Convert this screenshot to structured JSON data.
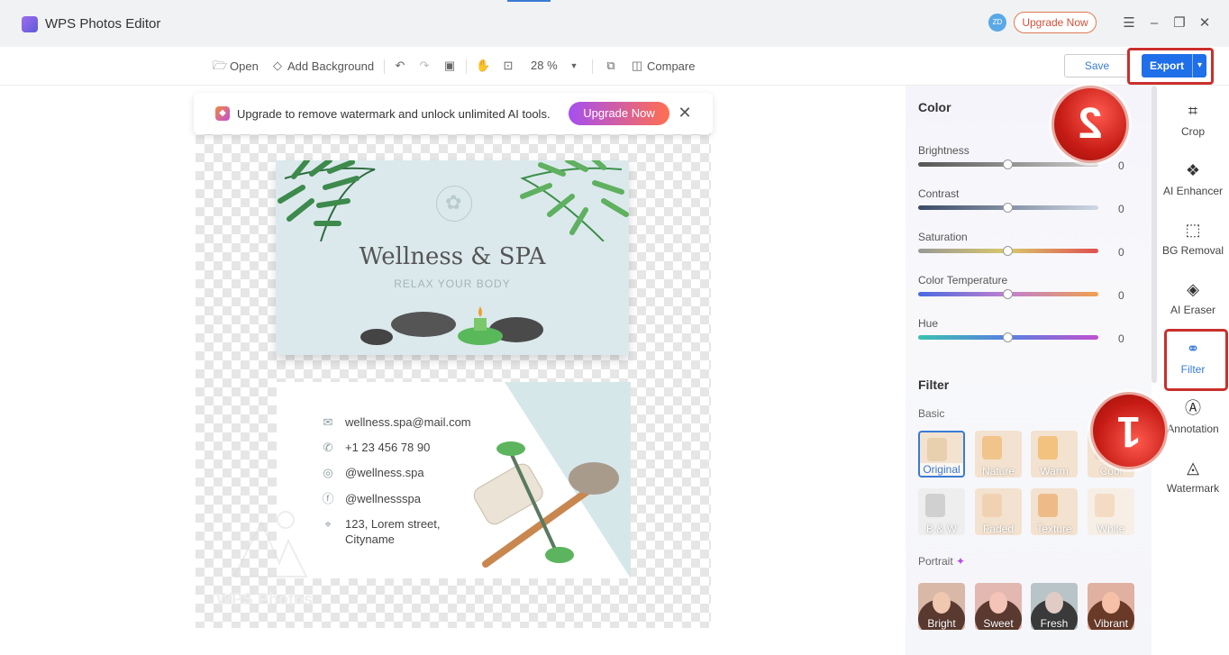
{
  "app": {
    "title": "WPS Photos Editor",
    "avatar": "ZD",
    "upgrade": "Upgrade Now"
  },
  "toolbar": {
    "open": "Open",
    "add_bg": "Add Background",
    "zoom": "28 %",
    "compare": "Compare",
    "save": "Save",
    "export": "Export"
  },
  "banner": {
    "text": "Upgrade to remove watermark and unlock unlimited AI tools.",
    "button": "Upgrade Now"
  },
  "card_front": {
    "title": "Wellness & SPA",
    "subtitle": "RELAX YOUR BODY"
  },
  "card_back": {
    "contacts": [
      {
        "icon": "mail-icon",
        "text": "wellness.spa@mail.com"
      },
      {
        "icon": "phone-icon",
        "text": "+1 23 456 78 90"
      },
      {
        "icon": "instagram-icon",
        "text": "@wellness.spa"
      },
      {
        "icon": "facebook-icon",
        "text": "@wellnessspa"
      },
      {
        "icon": "location-icon",
        "text": "123, Lorem street,\nCityname"
      }
    ]
  },
  "watermark": "WPS Photos",
  "panel": {
    "color_title": "Color",
    "sliders": [
      {
        "label": "Brightness",
        "value": "0"
      },
      {
        "label": "Contrast",
        "value": "0"
      },
      {
        "label": "Saturation",
        "value": "0"
      },
      {
        "label": "Color Temperature",
        "value": "0"
      },
      {
        "label": "Hue",
        "value": "0"
      }
    ],
    "filter_title": "Filter",
    "basic_label": "Basic",
    "basic": [
      "Original",
      "Nature",
      "Warm",
      "Cool",
      "B & W",
      "Faded",
      "Texture",
      "White"
    ],
    "portrait_label": "Portrait",
    "portrait": [
      "Bright",
      "Sweet",
      "Fresh",
      "Vibrant"
    ]
  },
  "tools": [
    {
      "label": "Crop",
      "icon": "crop-icon"
    },
    {
      "label": "AI Enhancer",
      "icon": "ai-enhancer-icon"
    },
    {
      "label": "BG Removal",
      "icon": "bg-removal-icon"
    },
    {
      "label": "AI Eraser",
      "icon": "eraser-icon"
    },
    {
      "label": "Filter",
      "icon": "filter-icon"
    },
    {
      "label": "Annotation",
      "icon": "annotation-icon"
    },
    {
      "label": "Watermark",
      "icon": "watermark-icon"
    }
  ],
  "badges": {
    "one": "1",
    "two": "2"
  }
}
